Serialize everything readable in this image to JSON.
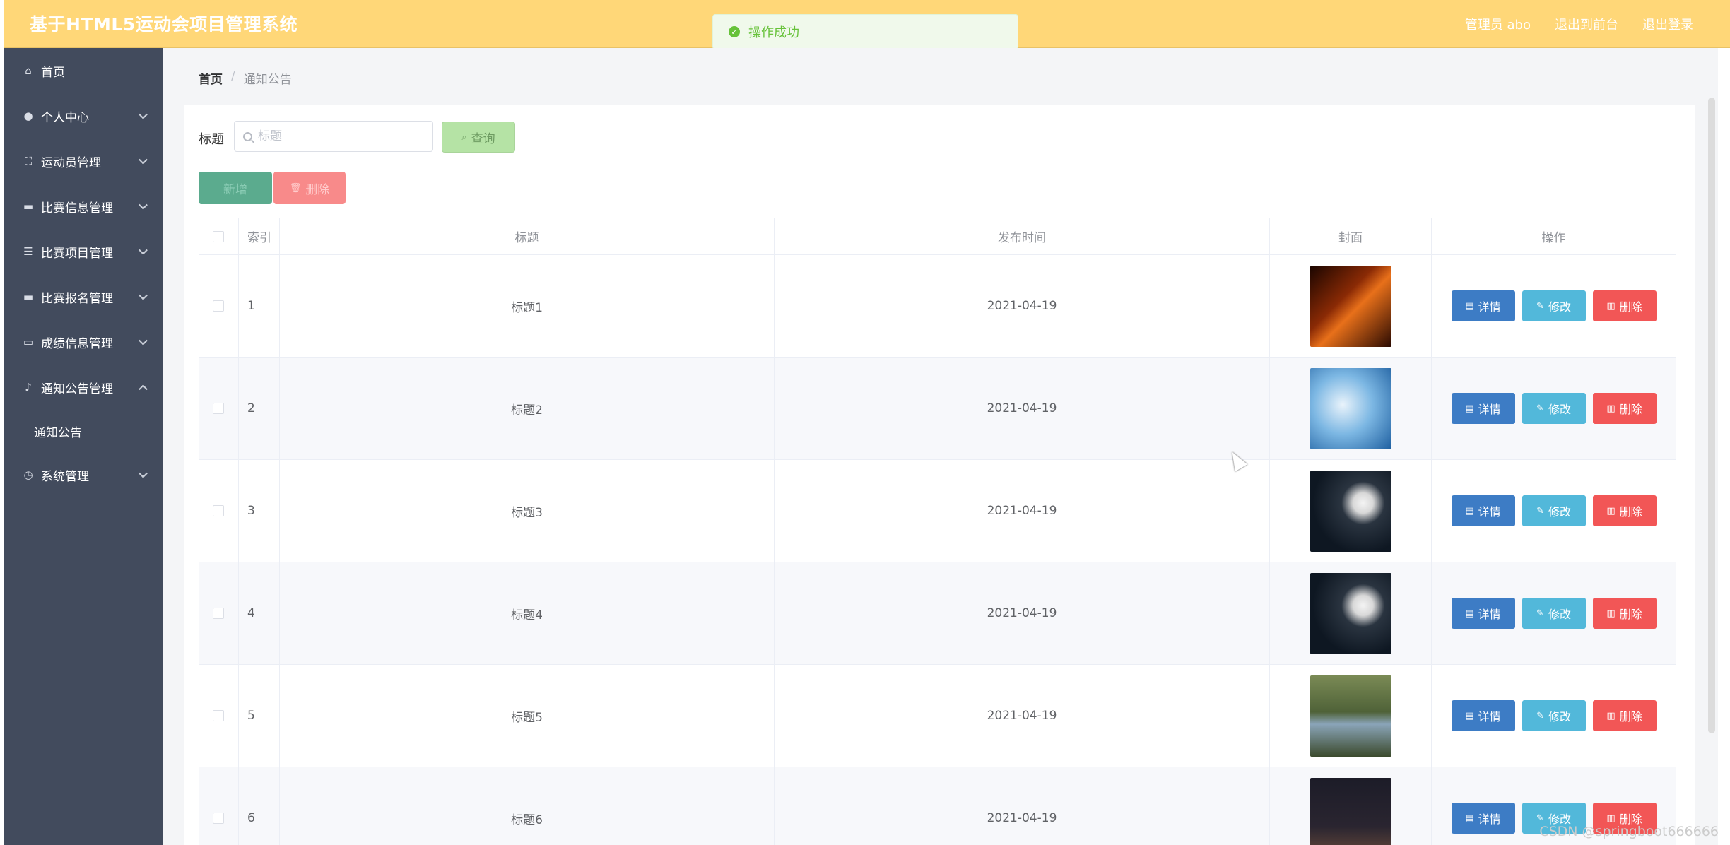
{
  "header": {
    "app_title": "基于HTML5运动会项目管理系统",
    "admin_label": "管理员 abo",
    "back_to_front": "退出到前台",
    "logout": "退出登录"
  },
  "toast": {
    "message": "操作成功",
    "icon": "check-circle-icon",
    "color": "#67c23a"
  },
  "sidebar": {
    "items": [
      {
        "label": "首页",
        "icon": "home-icon",
        "expandable": false
      },
      {
        "label": "个人中心",
        "icon": "user-icon",
        "expandable": true
      },
      {
        "label": "运动员管理",
        "icon": "scan-icon",
        "expandable": true
      },
      {
        "label": "比赛信息管理",
        "icon": "flag-icon",
        "expandable": true
      },
      {
        "label": "比赛项目管理",
        "icon": "sliders-icon",
        "expandable": true
      },
      {
        "label": "比赛报名管理",
        "icon": "flag-icon",
        "expandable": true
      },
      {
        "label": "成绩信息管理",
        "icon": "monitor-icon",
        "expandable": true
      },
      {
        "label": "通知公告管理",
        "icon": "mic-icon",
        "expandable": true,
        "expanded": true
      },
      {
        "label": "系统管理",
        "icon": "clock-icon",
        "expandable": true
      }
    ],
    "sub_item": "通知公告"
  },
  "breadcrumb": {
    "home": "首页",
    "separator": "/",
    "current": "通知公告"
  },
  "search": {
    "label": "标题",
    "placeholder": "标题",
    "value": "",
    "button": "查询"
  },
  "actions": {
    "add": "新增",
    "delete": "删除"
  },
  "table": {
    "columns": [
      "索引",
      "标题",
      "发布时间",
      "封面",
      "操作"
    ],
    "buttons": {
      "detail": "详情",
      "edit": "修改",
      "delete": "删除"
    },
    "rows": [
      {
        "index": "1",
        "title": "标题1",
        "date": "2021-04-19",
        "cover": "basketball-hoop"
      },
      {
        "index": "2",
        "title": "标题2",
        "date": "2021-04-19",
        "cover": "skateboard-jump"
      },
      {
        "index": "3",
        "title": "标题3",
        "date": "2021-04-19",
        "cover": "soccer-net"
      },
      {
        "index": "4",
        "title": "标题4",
        "date": "2021-04-19",
        "cover": "soccer-net"
      },
      {
        "index": "5",
        "title": "标题5",
        "date": "2021-04-19",
        "cover": "forest-runner"
      },
      {
        "index": "6",
        "title": "标题6",
        "date": "2021-04-19",
        "cover": "night-court"
      }
    ]
  },
  "watermark": "CSDN @springboot666666",
  "colors": {
    "header": "#ffd778",
    "sidebar": "#424b5d",
    "detail": "#3d7cc5",
    "edit": "#52b8da",
    "delete": "#f25656"
  }
}
